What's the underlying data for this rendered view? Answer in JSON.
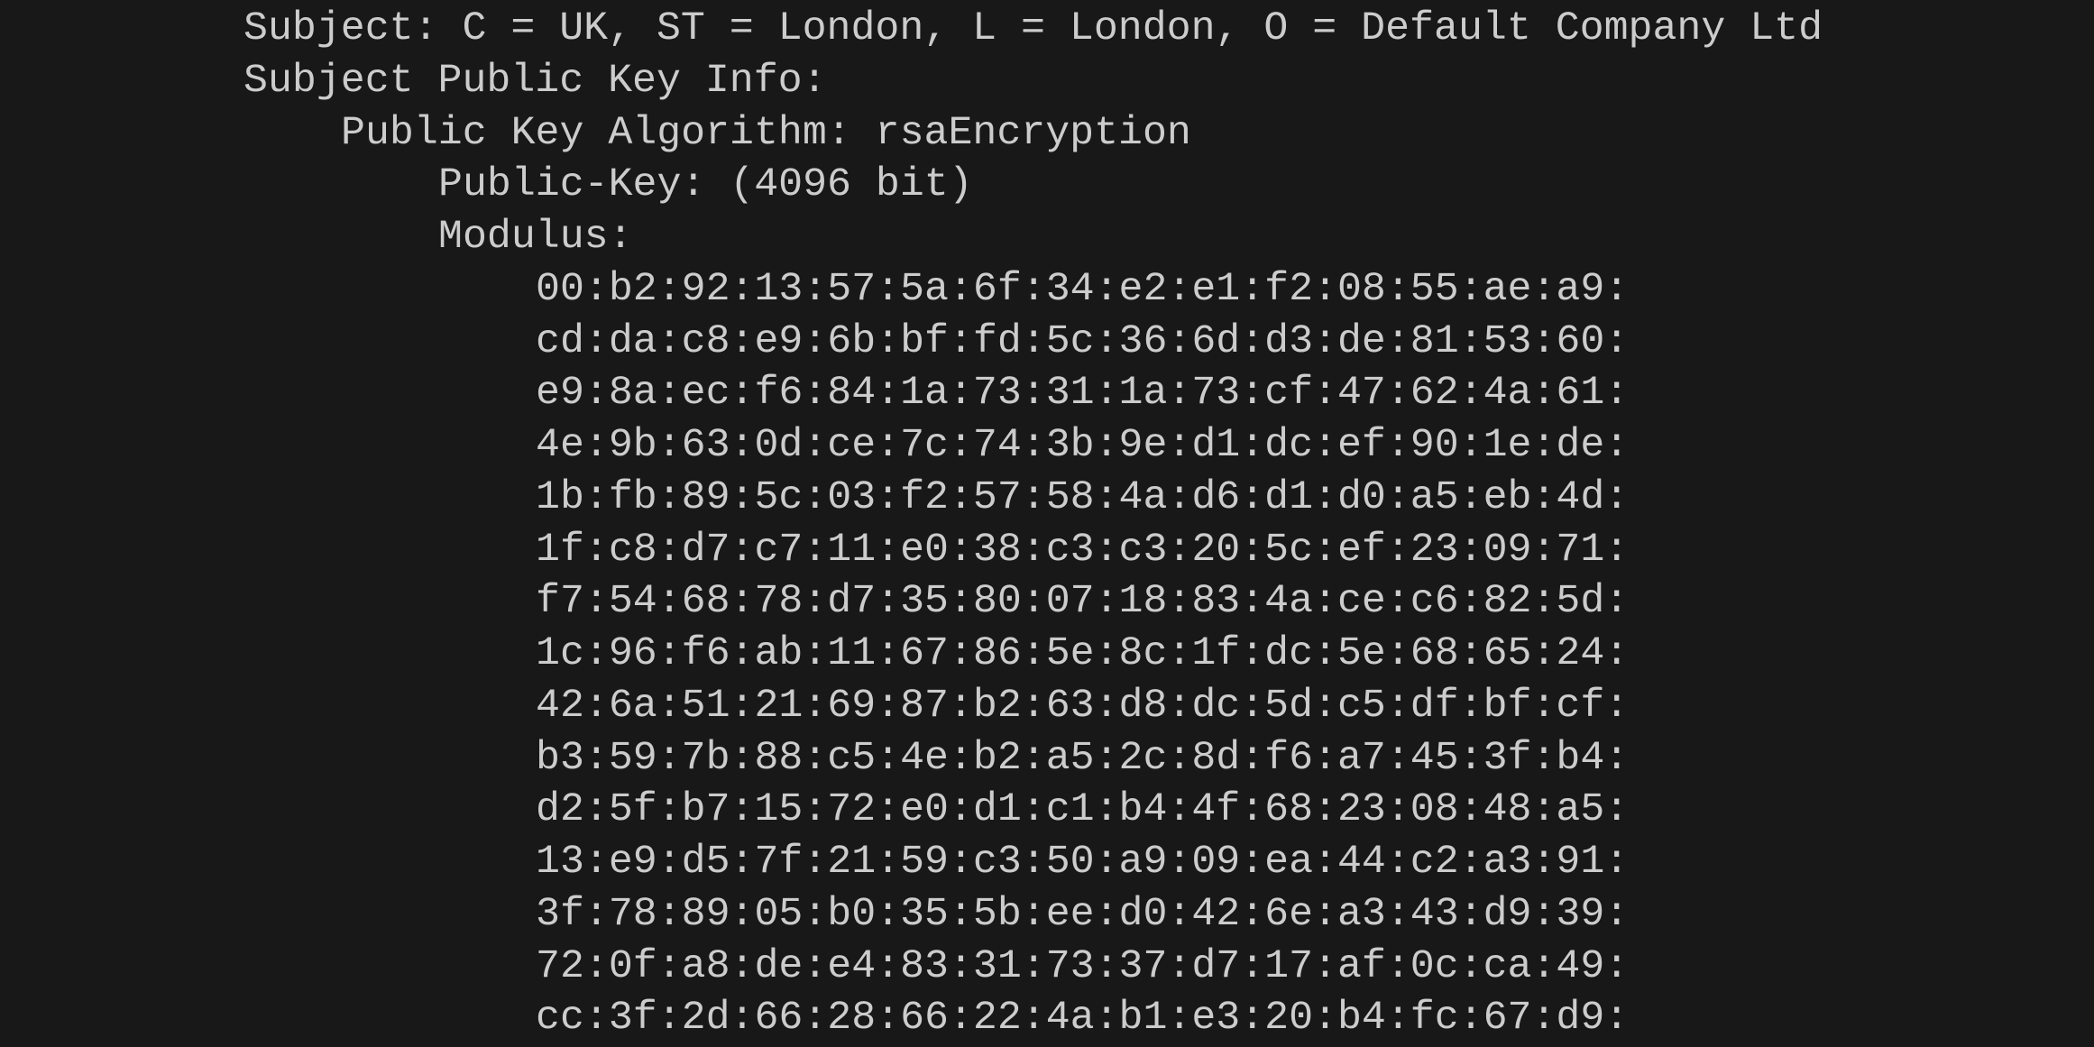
{
  "terminal": {
    "subject": "Subject: C = UK, ST = London, L = London, O = Default Company Ltd",
    "subject_public_key_info": "Subject Public Key Info:",
    "public_key_algorithm": "Public Key Algorithm: rsaEncryption",
    "public_key": "Public-Key: (4096 bit)",
    "modulus_label": "Modulus:",
    "modulus_lines": [
      "00:b2:92:13:57:5a:6f:34:e2:e1:f2:08:55:ae:a9:",
      "cd:da:c8:e9:6b:bf:fd:5c:36:6d:d3:de:81:53:60:",
      "e9:8a:ec:f6:84:1a:73:31:1a:73:cf:47:62:4a:61:",
      "4e:9b:63:0d:ce:7c:74:3b:9e:d1:dc:ef:90:1e:de:",
      "1b:fb:89:5c:03:f2:57:58:4a:d6:d1:d0:a5:eb:4d:",
      "1f:c8:d7:c7:11:e0:38:c3:c3:20:5c:ef:23:09:71:",
      "f7:54:68:78:d7:35:80:07:18:83:4a:ce:c6:82:5d:",
      "1c:96:f6:ab:11:67:86:5e:8c:1f:dc:5e:68:65:24:",
      "42:6a:51:21:69:87:b2:63:d8:dc:5d:c5:df:bf:cf:",
      "b3:59:7b:88:c5:4e:b2:a5:2c:8d:f6:a7:45:3f:b4:",
      "d2:5f:b7:15:72:e0:d1:c1:b4:4f:68:23:08:48:a5:",
      "13:e9:d5:7f:21:59:c3:50:a9:09:ea:44:c2:a3:91:",
      "3f:78:89:05:b0:35:5b:ee:d0:42:6e:a3:43:d9:39:",
      "72:0f:a8:de:e4:83:31:73:37:d7:17:af:0c:ca:49:",
      "cc:3f:2d:66:28:66:22:4a:b1:e3:20:b4:fc:67:d9:"
    ]
  }
}
